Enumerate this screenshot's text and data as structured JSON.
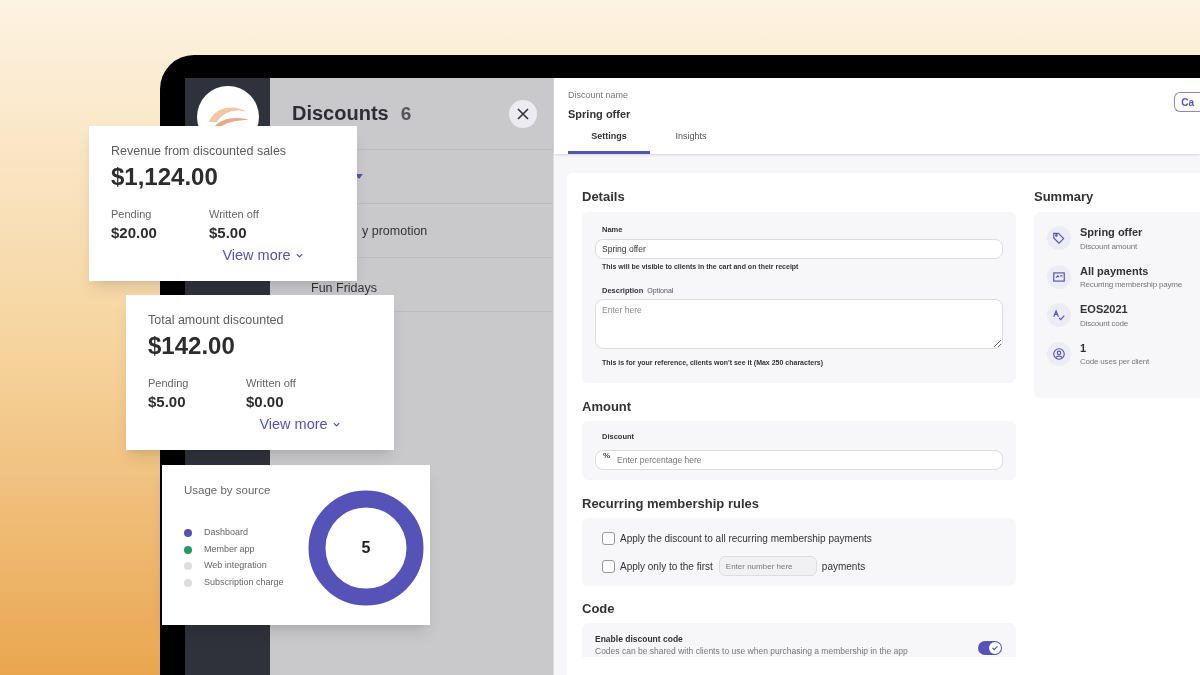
{
  "discounts_panel": {
    "title": "Discounts",
    "count": "6",
    "items": [
      {
        "name": "y promotion"
      },
      {
        "name": "Fun Fridays"
      }
    ]
  },
  "discount": {
    "name_label": "Discount name",
    "name": "Spring offer",
    "cancel_button": "Ca",
    "tabs": [
      {
        "label": "Settings",
        "selected": true
      },
      {
        "label": "Insights",
        "selected": false
      }
    ]
  },
  "details": {
    "title": "Details",
    "name_label": "Name",
    "name_value": "Spring offer",
    "name_help": "This will be visible to clients in the cart and on their receipt",
    "description_label": "Description",
    "description_optional": "Optional",
    "description_placeholder": "Enter here",
    "description_help": "This is for your reference, clients won't see it (Max 250 characters)"
  },
  "amount": {
    "title": "Amount",
    "discount_label": "Discount",
    "prefix": "%",
    "placeholder": "Enter percentage here"
  },
  "recurring": {
    "title": "Recurring membership rules",
    "options": [
      {
        "kind": "plain",
        "label": "Apply the discount to all recurring membership payments",
        "checked": false
      },
      {
        "kind": "number",
        "label": "Apply only to the first",
        "placeholder": "Enter number here",
        "suffix": "payments",
        "checked": false
      }
    ]
  },
  "code": {
    "title": "Code",
    "toggle_label": "Enable discount code",
    "toggle_help": "Codes can be shared with clients to use when purchasing a membership in the app",
    "on": true
  },
  "summary": {
    "title": "Summary",
    "items": [
      {
        "kind": "tag",
        "title": "Spring offer",
        "subtitle": "Discount amount"
      },
      {
        "kind": "card",
        "title": "All payments",
        "subtitle": "Recurring membership payme"
      },
      {
        "kind": "code",
        "title": "EOS2021",
        "subtitle": "Discount code"
      },
      {
        "kind": "user",
        "title": "1",
        "subtitle": "Code uses per client"
      }
    ]
  },
  "stat_cards": [
    {
      "title": "Revenue from discounted sales",
      "value": "$1,124.00",
      "pending_label": "Pending",
      "pending": "$20.00",
      "written_off_label": "Written off",
      "written_off": "$5.00",
      "link": "View more"
    },
    {
      "title": "Total amount discounted",
      "value": "$142.00",
      "pending_label": "Pending",
      "pending": "$5.00",
      "written_off_label": "Written off",
      "written_off": "$0.00",
      "link": "View more"
    }
  ],
  "usage_card": {
    "title": "Usage by source",
    "total": "5",
    "legend": [
      {
        "label": "Dashboard",
        "color": "#5552b8"
      },
      {
        "label": "Member app",
        "color": "#239a63"
      },
      {
        "label": "Web integration",
        "color": "#dddddd"
      },
      {
        "label": "Subscription charge",
        "color": "#dddddd"
      }
    ]
  }
}
